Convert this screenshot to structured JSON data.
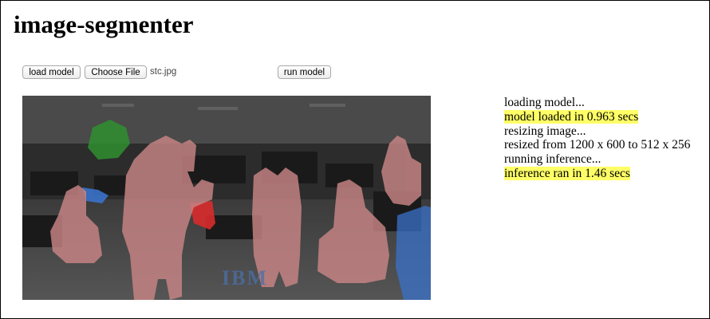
{
  "page": {
    "title": "image-segmenter"
  },
  "controls": {
    "load_model_label": "load model",
    "choose_file_label": "Choose File",
    "file_name": "stc.jpg",
    "run_model_label": "run model"
  },
  "canvas": {
    "overlay_text": "IBM",
    "colors": {
      "person": "#c98585",
      "plant": "#2f8f2f",
      "monitor": "#3a72c9",
      "bag": "#d92b2b",
      "background": "#2f2f2f"
    }
  },
  "log": {
    "lines": [
      {
        "text": "loading model...",
        "highlight": false
      },
      {
        "text": "model loaded in 0.963 secs",
        "highlight": true
      },
      {
        "text": "resizing image...",
        "highlight": false
      },
      {
        "text": "resized from 1200 x 600 to 512 x 256",
        "highlight": false
      },
      {
        "text": "running inference...",
        "highlight": false
      },
      {
        "text": "inference ran in 1.46 secs",
        "highlight": true
      }
    ],
    "highlight_color": "#ffff66"
  }
}
